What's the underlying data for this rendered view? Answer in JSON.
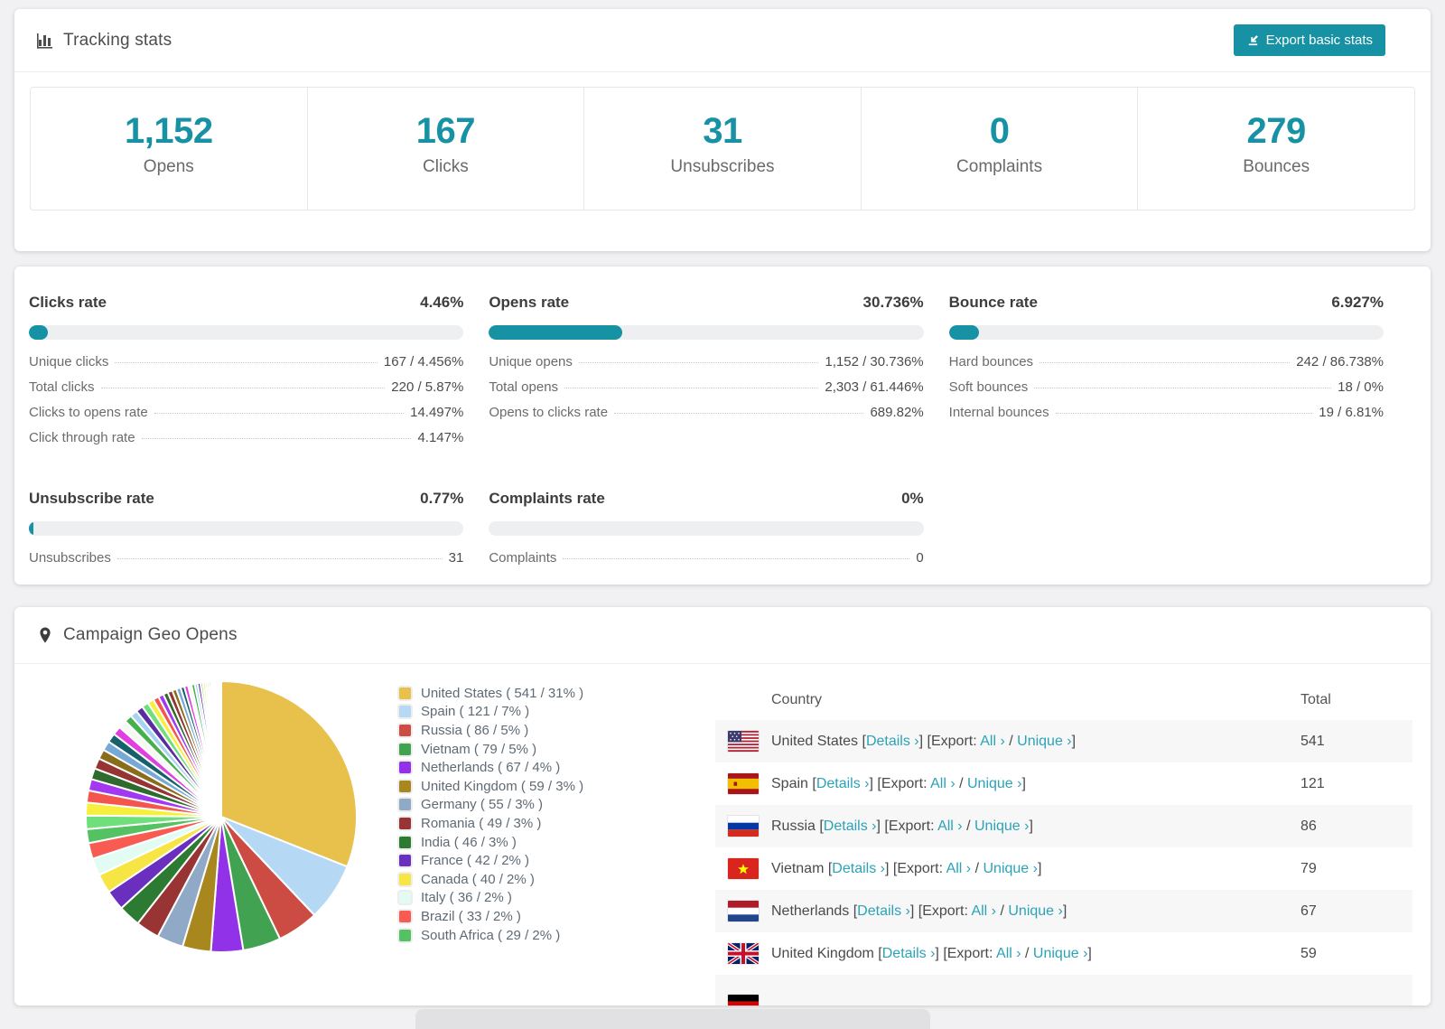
{
  "colors": {
    "accent_teal": "#1791A4",
    "number_teal": "#1792A5",
    "link_teal": "#2BA3B7",
    "bar_track": "#EDEFF1",
    "row_stripe": "#F7F7F8",
    "page_bg": "#F1F1F3"
  },
  "tracking": {
    "title": "Tracking stats",
    "export_button": "Export basic stats",
    "stats": [
      {
        "value": "1,152",
        "label": "Opens"
      },
      {
        "value": "167",
        "label": "Clicks"
      },
      {
        "value": "31",
        "label": "Unsubscribes"
      },
      {
        "value": "0",
        "label": "Complaints"
      },
      {
        "value": "279",
        "label": "Bounces"
      }
    ]
  },
  "rates": {
    "panels": [
      {
        "title": "Clicks rate",
        "value": "4.46%",
        "pct": 4.46,
        "rows": [
          {
            "label": "Unique clicks",
            "value": "167 / 4.456%"
          },
          {
            "label": "Total clicks",
            "value": "220 / 5.87%"
          },
          {
            "label": "Clicks to opens rate",
            "value": "14.497%"
          },
          {
            "label": "Click through rate",
            "value": "4.147%"
          }
        ]
      },
      {
        "title": "Opens rate",
        "value": "30.736%",
        "pct": 30.736,
        "rows": [
          {
            "label": "Unique opens",
            "value": "1,152 / 30.736%"
          },
          {
            "label": "Total opens",
            "value": "2,303 / 61.446%"
          },
          {
            "label": "Opens to clicks rate",
            "value": "689.82%"
          }
        ]
      },
      {
        "title": "Bounce rate",
        "value": "6.927%",
        "pct": 6.927,
        "rows": [
          {
            "label": "Hard bounces",
            "value": "242 / 86.738%"
          },
          {
            "label": "Soft bounces",
            "value": "18 / 0%"
          },
          {
            "label": "Internal bounces",
            "value": "19 / 6.81%"
          }
        ]
      },
      {
        "title": "Unsubscribe rate",
        "value": "0.77%",
        "pct": 0.77,
        "rows": [
          {
            "label": "Unsubscribes",
            "value": "31"
          }
        ]
      },
      {
        "title": "Complaints rate",
        "value": "0%",
        "pct": 0,
        "rows": [
          {
            "label": "Complaints",
            "value": "0"
          }
        ]
      }
    ]
  },
  "chart_data": {
    "type": "pie",
    "title": "Campaign Geo Opens",
    "legend_position": "right",
    "start_angle_deg": -90,
    "direction": "clockwise",
    "slices": [
      {
        "label": "United States",
        "value": 541,
        "pct": 31,
        "color": "#E7C14B"
      },
      {
        "label": "Spain",
        "value": 121,
        "pct": 7,
        "color": "#B5D9F5"
      },
      {
        "label": "Russia",
        "value": 86,
        "pct": 5,
        "color": "#CC4B42"
      },
      {
        "label": "Vietnam",
        "value": 79,
        "pct": 5,
        "color": "#41A351"
      },
      {
        "label": "Netherlands",
        "value": 67,
        "pct": 4,
        "color": "#9232E8"
      },
      {
        "label": "United Kingdom",
        "value": 59,
        "pct": 3,
        "color": "#A8871E"
      },
      {
        "label": "Germany",
        "value": 55,
        "pct": 3,
        "color": "#8FA9C6"
      },
      {
        "label": "Romania",
        "value": 49,
        "pct": 3,
        "color": "#993434"
      },
      {
        "label": "India",
        "value": 46,
        "pct": 3,
        "color": "#2D7A32"
      },
      {
        "label": "France",
        "value": 42,
        "pct": 2,
        "color": "#6A2FBF"
      },
      {
        "label": "Canada",
        "value": 40,
        "pct": 2,
        "color": "#F6E545"
      },
      {
        "label": "Italy",
        "value": 36,
        "pct": 2,
        "color": "#E2FBF3"
      },
      {
        "label": "Brazil",
        "value": 33,
        "pct": 2,
        "color": "#F85B52"
      },
      {
        "label": "South Africa",
        "value": 29,
        "pct": 2,
        "color": "#54C263"
      }
    ],
    "unlabeled_tail": {
      "note": "many small unlabeled country slices of decreasing size",
      "values": [
        28,
        27,
        25,
        24,
        23,
        22,
        20,
        20,
        19,
        18,
        17,
        16,
        15,
        15,
        14,
        13,
        12,
        11,
        10,
        10,
        9,
        9,
        8,
        8,
        7,
        7,
        6,
        6,
        5,
        5,
        4,
        4,
        4,
        3,
        3,
        3,
        2,
        2,
        2,
        2,
        1,
        1,
        1,
        1
      ],
      "palette": [
        "#6FDF7C",
        "#F7EF3E",
        "#F4564E",
        "#A238F0",
        "#2E6B2E",
        "#963434",
        "#8A6D1A",
        "#76A9D6",
        "#17616B",
        "#E23FE2",
        "#F6F8F2",
        "#46B14C",
        "#A7D3F2",
        "#5A2DA0"
      ]
    }
  },
  "geo": {
    "title": "Campaign Geo Opens",
    "legend_format": "( value / pct% )",
    "table": {
      "headers": {
        "country": "Country",
        "total": "Total"
      },
      "links": {
        "details": "Details",
        "export": "Export:",
        "all": "All",
        "unique": "Unique",
        "chevron": "›"
      },
      "rows": [
        {
          "country": "United States",
          "flag": "us",
          "total": "541",
          "partial": false
        },
        {
          "country": "Spain",
          "flag": "es",
          "total": "121",
          "partial": false
        },
        {
          "country": "Russia",
          "flag": "ru",
          "total": "86",
          "partial": false
        },
        {
          "country": "Vietnam",
          "flag": "vn",
          "total": "79",
          "partial": false
        },
        {
          "country": "Netherlands",
          "flag": "nl",
          "total": "67",
          "partial": false
        },
        {
          "country": "United Kingdom",
          "flag": "gb",
          "total": "59",
          "partial": false
        },
        {
          "country": "",
          "flag": "de",
          "total": "",
          "partial": true
        }
      ]
    }
  }
}
